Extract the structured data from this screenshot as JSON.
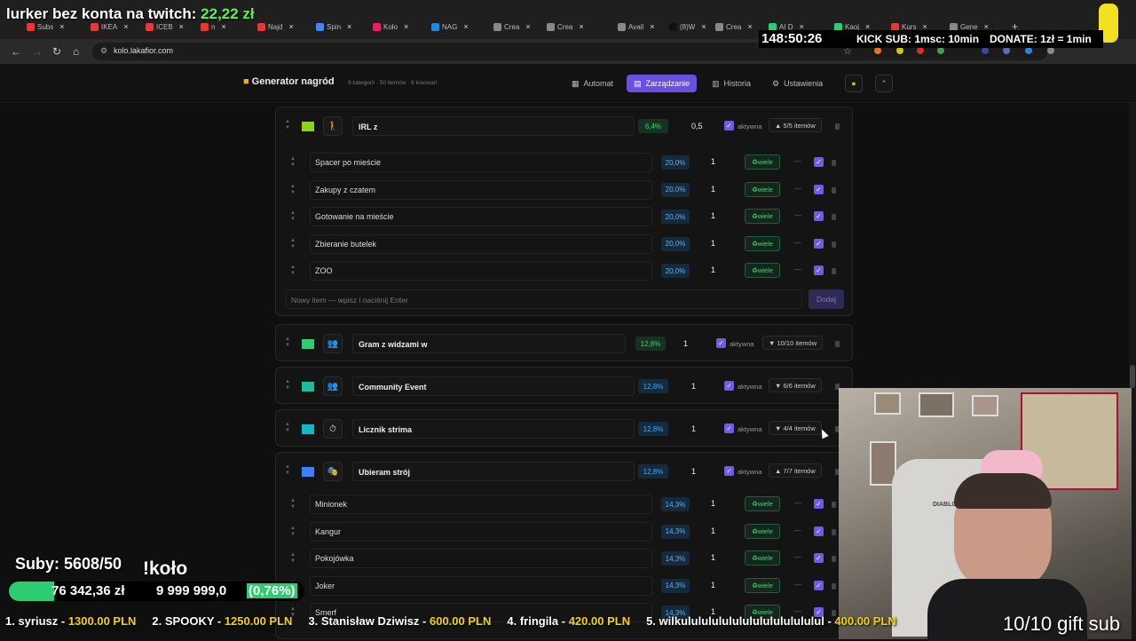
{
  "browser": {
    "tabs": [
      {
        "label": "Subs",
        "color": "#e53935"
      },
      {
        "label": "IKEA",
        "color": "#e53935"
      },
      {
        "label": "ICEB",
        "color": "#e53935"
      },
      {
        "label": "n",
        "color": "#e53935"
      },
      {
        "label": "Najd",
        "color": "#e53935"
      },
      {
        "label": "Spin",
        "color": "#4285f4"
      },
      {
        "label": "Koło",
        "color": "#e91e63"
      },
      {
        "label": "NAG",
        "color": "#1e88e5"
      },
      {
        "label": "Crea",
        "color": "#888888"
      },
      {
        "label": "Crea",
        "color": "#888888"
      },
      {
        "label": "Avail",
        "color": "#888888"
      },
      {
        "label": "(8)W",
        "color": "#111111"
      },
      {
        "label": "Crea",
        "color": "#888888"
      },
      {
        "label": "AI D",
        "color": "#2ecc71"
      },
      {
        "label": "Kaoj",
        "color": "#2ecc71"
      },
      {
        "label": "Kurs",
        "color": "#e53935"
      },
      {
        "label": "Gene",
        "color": "#888888"
      }
    ],
    "url": "kolo.lakafior.com"
  },
  "app": {
    "brand": "Generator nagród",
    "subtitle": "9 kategorii · 50 itemów · 6 losowań",
    "menu": [
      "Automat",
      "Zarządzanie",
      "Historia",
      "Ustawienia"
    ],
    "active_menu": "Zarządzanie"
  },
  "labels": {
    "aktywna": "aktywna",
    "wiele": "wiele",
    "dash": "—",
    "new_item_placeholder": "Nowy item — wpisz i naciśnij Enter",
    "add_button": "Dodaj"
  },
  "categories": [
    {
      "name": "IRL z",
      "color": "#8bd317",
      "icon": "🚶",
      "percent": "6,4%",
      "pct_style": "g",
      "weight": "0,5",
      "toggle": "▲ 5/5 itemów",
      "items": [
        {
          "name": "Spacer po mieście",
          "percent": "20,0%",
          "weight": "1"
        },
        {
          "name": "Zakupy z czatem",
          "percent": "20,0%",
          "weight": "1"
        },
        {
          "name": "Gotowanie na mieście",
          "percent": "20,0%",
          "weight": "1"
        },
        {
          "name": "Zbieranie butelek",
          "percent": "20,0%",
          "weight": "1"
        },
        {
          "name": "ZOO",
          "percent": "20,0%",
          "weight": "1"
        }
      ]
    },
    {
      "name": "Gram z widzami w",
      "color": "#2ecc71",
      "icon": "👥",
      "percent": "12,8%",
      "pct_style": "g",
      "weight": "1",
      "toggle": "▼ 10/10 itemów"
    },
    {
      "name": "Community Event",
      "color": "#1abc9c",
      "icon": "👥",
      "percent": "12,8%",
      "pct_style": "b",
      "weight": "1",
      "toggle": "▼ 6/6 itemów"
    },
    {
      "name": "Licznik strima",
      "color": "#17b5c9",
      "icon": "⏱",
      "percent": "12,8%",
      "pct_style": "b",
      "weight": "1",
      "toggle": "▼ 4/4 itemów"
    },
    {
      "name": "Ubieram strój",
      "color": "#3b82f6",
      "icon": "🎭",
      "percent": "12,8%",
      "pct_style": "b",
      "weight": "1",
      "toggle": "▲ 7/7 itemów",
      "items": [
        {
          "name": "Minionek",
          "percent": "14,3%",
          "weight": "1"
        },
        {
          "name": "Kangur",
          "percent": "14,3%",
          "weight": "1"
        },
        {
          "name": "Pokojówka",
          "percent": "14,3%",
          "weight": "1"
        },
        {
          "name": "Joker",
          "percent": "14,3%",
          "weight": "1"
        },
        {
          "name": "Smerf",
          "percent": "14,3%",
          "weight": "1"
        }
      ]
    }
  ],
  "overlay": {
    "lurker_text": "lurker bez konta na twitch:",
    "lurker_amount": "22,22 zł",
    "timer": "148:50:26",
    "kick": "KICK SUB: 1msc: 10min",
    "donate": "DONATE: 1zł = 1min",
    "suby": "Suby: 5608/50",
    "kolo": "!koło",
    "raised": "76 342,36 zł",
    "goal": "9 999 999,0",
    "goal_pct": "(0,76%)",
    "progress_fraction": 0.0076,
    "gift": "10/10 gift sub",
    "cam_label": "DIABLO",
    "ticker": [
      {
        "rank": "1. syriusz - ",
        "amount": "1300.00 PLN"
      },
      {
        "rank": "2. SPOOKY - ",
        "amount": "1250.00 PLN"
      },
      {
        "rank": "3. Stanisław Dziwisz - ",
        "amount": "600.00 PLN"
      },
      {
        "rank": "4. fringila - ",
        "amount": "420.00 PLN"
      },
      {
        "rank": "5. wilkulululululululululululululul - ",
        "amount": "400.00 PLN"
      }
    ]
  }
}
